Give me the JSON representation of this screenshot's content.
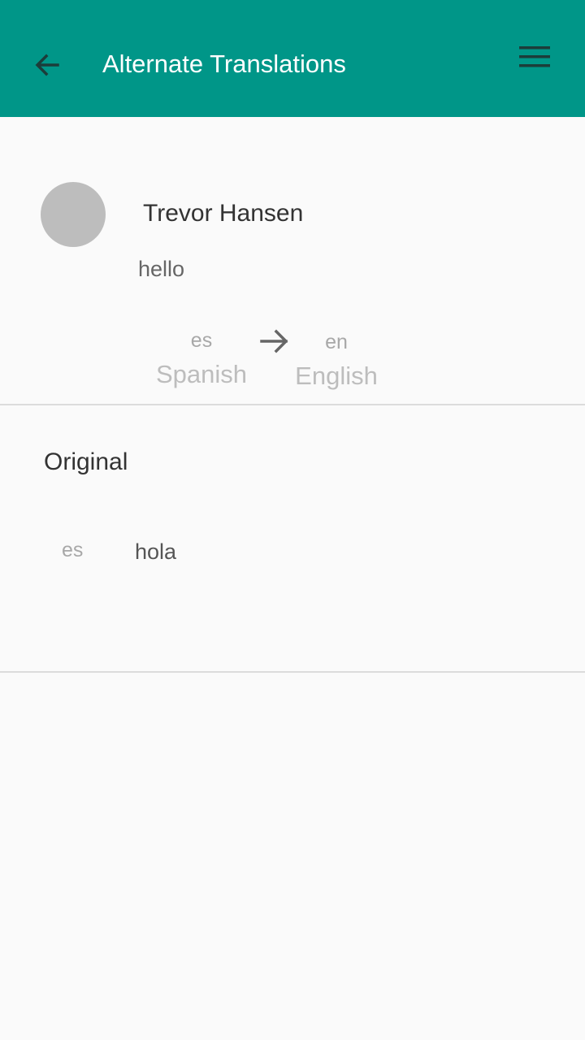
{
  "app_bar": {
    "title": "Alternate Translations",
    "background_color": "#009688",
    "back_icon": "arrow-back-icon",
    "menu_icon": "hamburger-menu-icon"
  },
  "translation": {
    "user_name": "Trevor Hansen",
    "message": "hello",
    "from": {
      "code": "es",
      "name": "Spanish"
    },
    "to": {
      "code": "en",
      "name": "English"
    },
    "direction_icon": "arrow-right-icon"
  },
  "original": {
    "section_title": "Original",
    "language_code": "es",
    "text": "hola"
  }
}
